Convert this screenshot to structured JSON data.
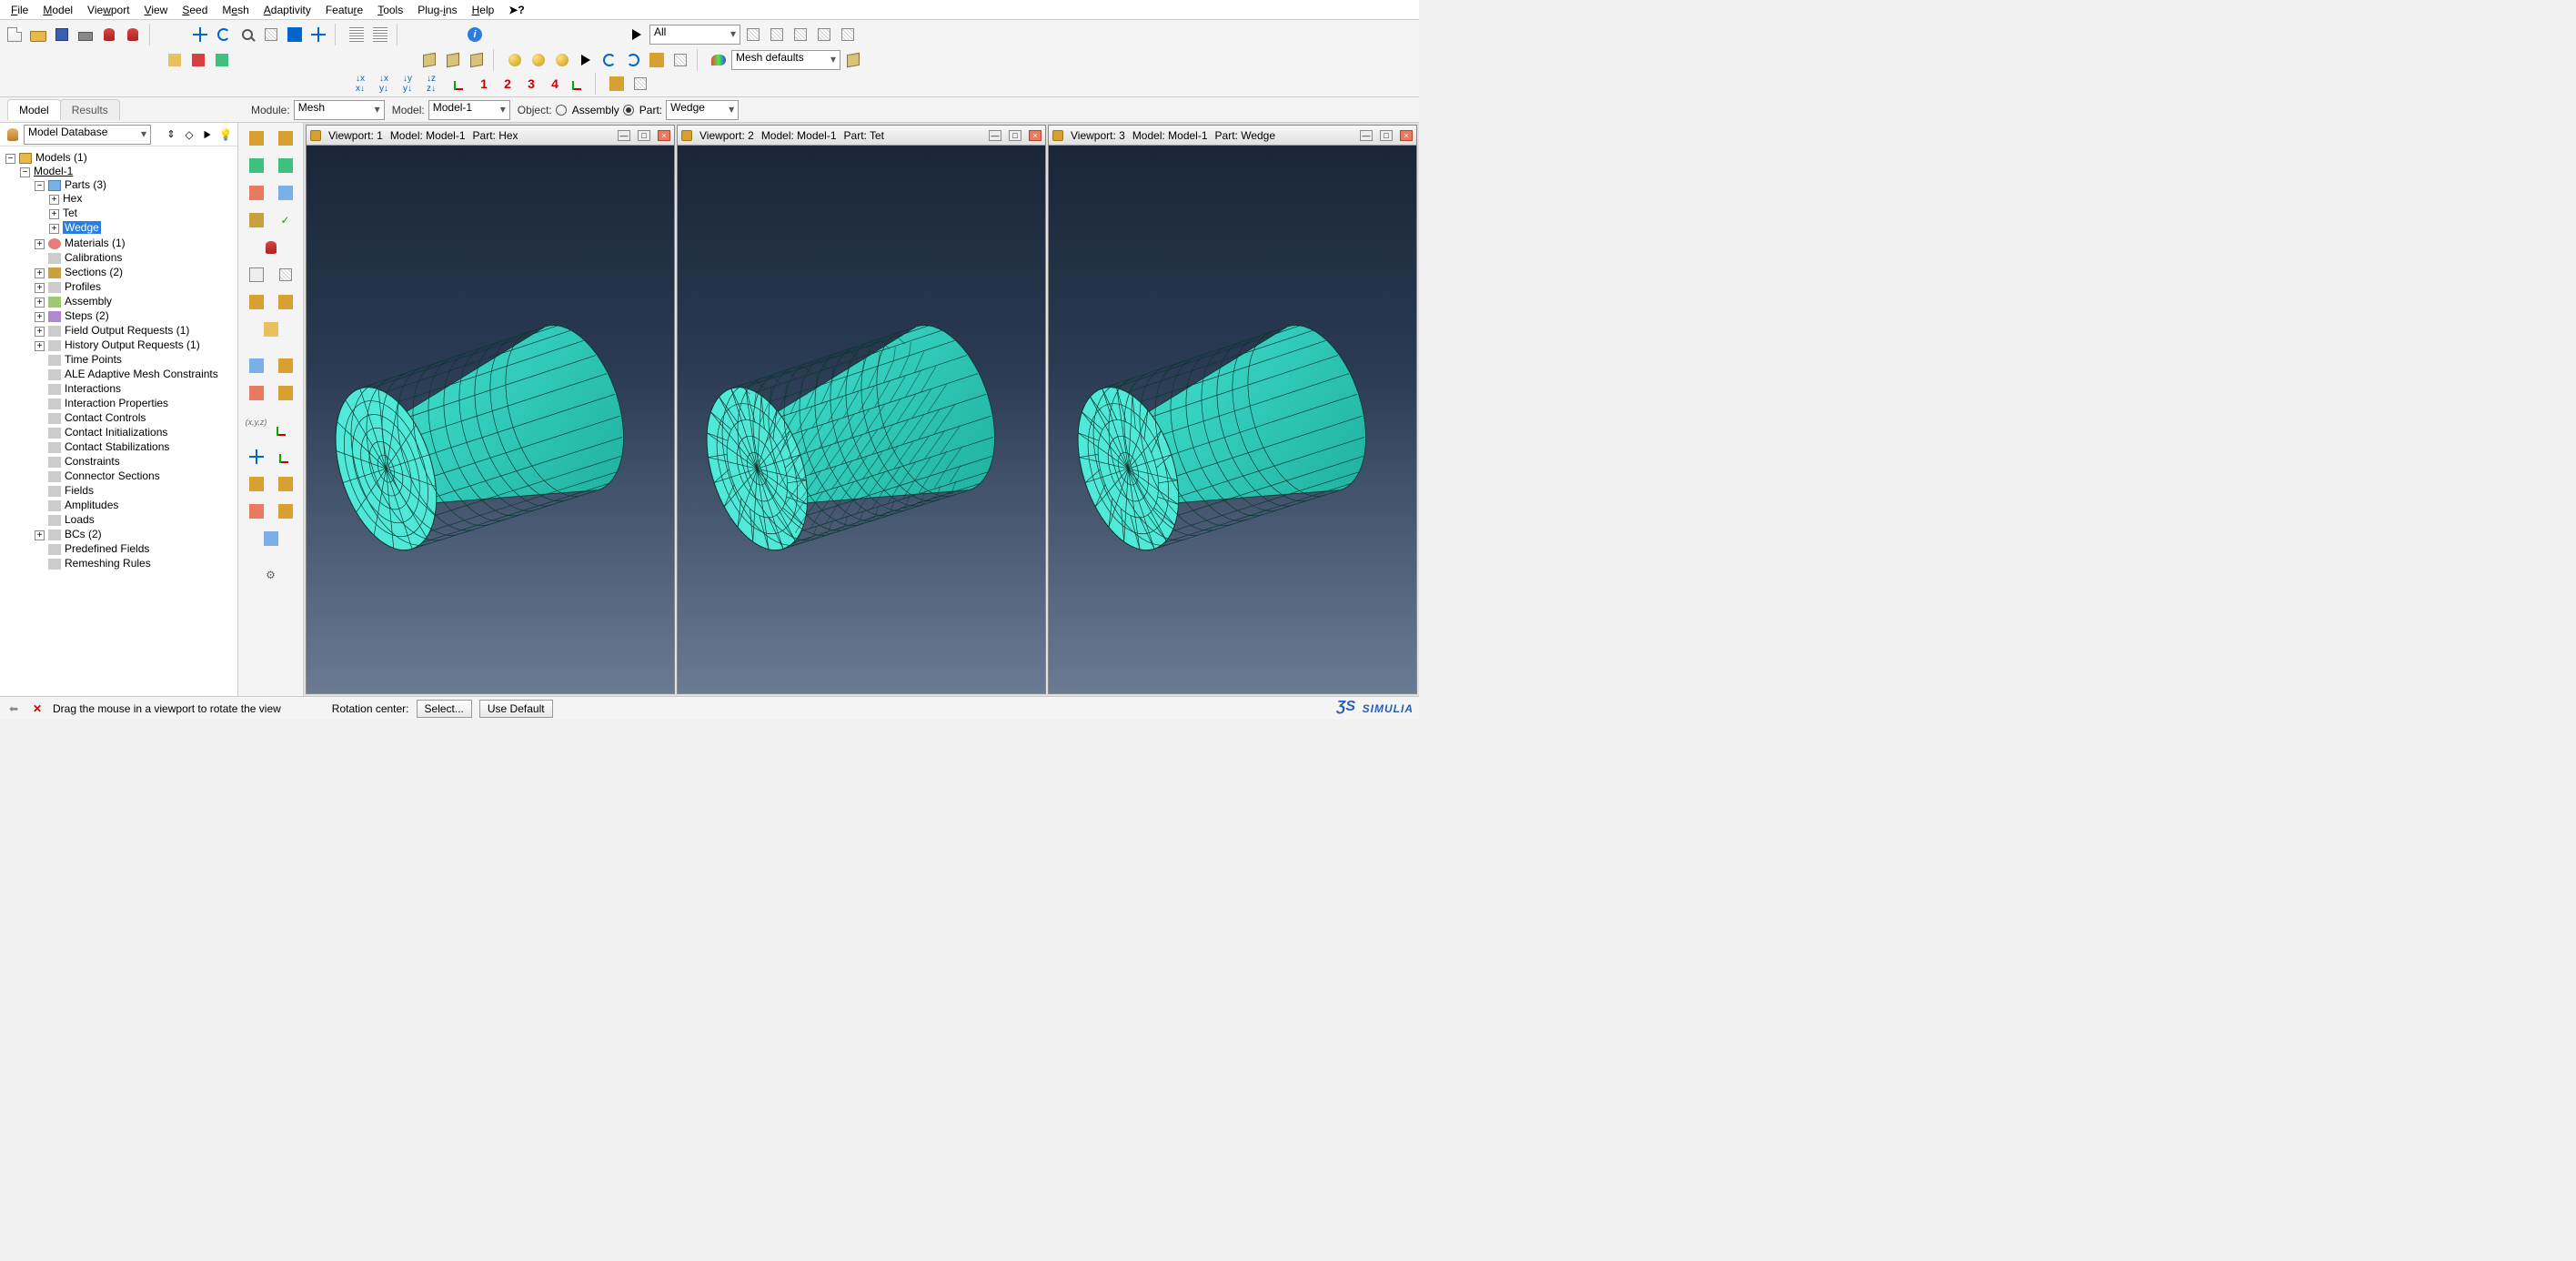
{
  "menu": [
    "File",
    "Model",
    "Viewport",
    "View",
    "Seed",
    "Mesh",
    "Adaptivity",
    "Feature",
    "Tools",
    "Plug-ins",
    "Help"
  ],
  "context": {
    "module_label": "Module:",
    "module_value": "Mesh",
    "model_label": "Model:",
    "model_value": "Model-1",
    "object_label": "Object:",
    "assembly_label": "Assembly",
    "part_label": "Part:",
    "part_value": "Wedge"
  },
  "toolbar2": {
    "select_value": "All",
    "mesh_defaults": "Mesh defaults"
  },
  "left_tabs": {
    "model": "Model",
    "results": "Results"
  },
  "tree_source": "Model Database",
  "tree": {
    "root": "Models (1)",
    "model": "Model-1",
    "parts_label": "Parts (3)",
    "parts": [
      "Hex",
      "Tet",
      "Wedge"
    ],
    "selected_part": "Wedge",
    "items": [
      "Materials (1)",
      "Calibrations",
      "Sections (2)",
      "Profiles",
      "Assembly",
      "Steps (2)",
      "Field Output Requests (1)",
      "History Output Requests (1)",
      "Time Points",
      "ALE Adaptive Mesh Constraints",
      "Interactions",
      "Interaction Properties",
      "Contact Controls",
      "Contact Initializations",
      "Contact Stabilizations",
      "Constraints",
      "Connector Sections",
      "Fields",
      "Amplitudes",
      "Loads",
      "BCs (2)",
      "Predefined Fields",
      "Remeshing Rules"
    ]
  },
  "viewports": [
    {
      "num": "1",
      "title": "Viewport: 1",
      "model": "Model: Model-1",
      "part": "Part: Hex"
    },
    {
      "num": "2",
      "title": "Viewport: 2",
      "model": "Model: Model-1",
      "part": "Part: Tet"
    },
    {
      "num": "3",
      "title": "Viewport: 3",
      "model": "Model: Model-1",
      "part": "Part: Wedge"
    }
  ],
  "status": {
    "hint": "Drag the mouse in a viewport to rotate the view",
    "rot_center_label": "Rotation center:",
    "select_btn": "Select...",
    "default_btn": "Use Default",
    "brand": "SIMULIA"
  },
  "csys_nums": [
    "1",
    "2",
    "3",
    "4"
  ]
}
